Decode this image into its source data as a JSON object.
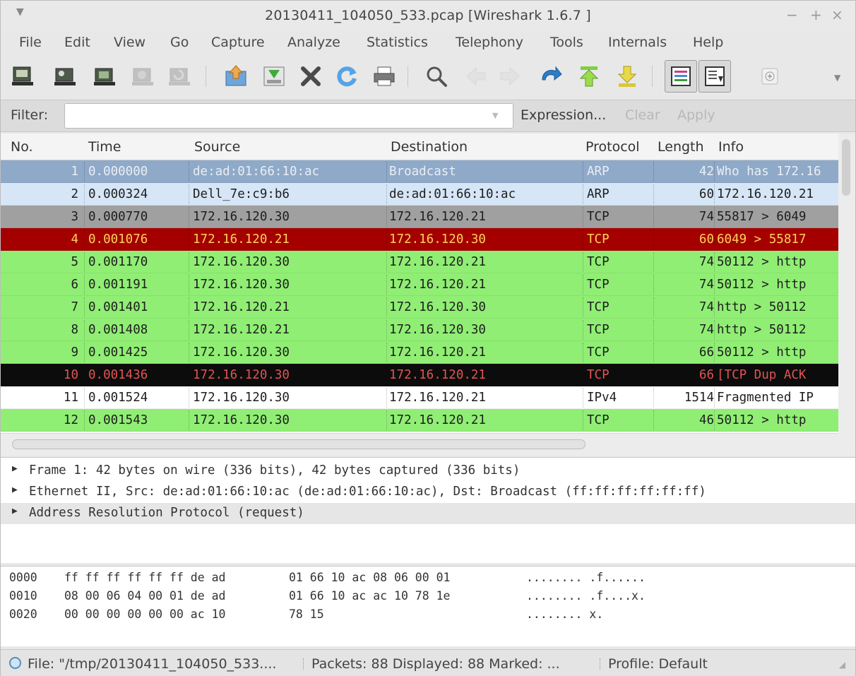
{
  "window": {
    "title": "20130411_104050_533.pcap   [Wireshark 1.6.7 ]",
    "controls": {
      "minimize": "−",
      "maximize": "+",
      "close": "×"
    }
  },
  "menu": [
    "File",
    "Edit",
    "View",
    "Go",
    "Capture",
    "Analyze",
    "Statistics",
    "Telephony",
    "Tools",
    "Internals",
    "Help"
  ],
  "toolbar": {
    "icons": [
      "interfaces-icon",
      "options-icon",
      "start-capture-icon",
      "stop-capture-icon",
      "restart-capture-icon",
      "open-file-icon",
      "save-file-icon",
      "close-file-icon",
      "reload-icon",
      "print-icon",
      "find-icon",
      "go-back-icon",
      "go-forward-icon",
      "go-to-packet-icon",
      "first-packet-icon",
      "last-packet-icon",
      "colorize-icon",
      "autoscroll-icon",
      "zoom-in-icon"
    ]
  },
  "filter": {
    "label": "Filter:",
    "value": "",
    "expression": "Expression...",
    "clear": "Clear",
    "apply": "Apply"
  },
  "packet_list": {
    "columns": [
      "No.",
      "Time",
      "Source",
      "Destination",
      "Protocol",
      "Length",
      "Info"
    ],
    "rows": [
      {
        "no": "1",
        "time": "0.000000",
        "source": "de:ad:01:66:10:ac",
        "destination": "Broadcast",
        "protocol": "ARP",
        "length": "42",
        "info": "Who has 172.16",
        "bg": "#8fa9c8",
        "fg": "#e9eef5"
      },
      {
        "no": "2",
        "time": "0.000324",
        "source": "Dell_7e:c9:b6",
        "destination": "de:ad:01:66:10:ac",
        "protocol": "ARP",
        "length": "60",
        "info": "172.16.120.21",
        "bg": "#d6e6f7",
        "fg": "#1e1e1e"
      },
      {
        "no": "3",
        "time": "0.000770",
        "source": "172.16.120.30",
        "destination": "172.16.120.21",
        "protocol": "TCP",
        "length": "74",
        "info": "55817 > 6049",
        "bg": "#a0a0a0",
        "fg": "#1e1e1e"
      },
      {
        "no": "4",
        "time": "0.001076",
        "source": "172.16.120.21",
        "destination": "172.16.120.30",
        "protocol": "TCP",
        "length": "60",
        "info": "6049 > 55817",
        "bg": "#a40000",
        "fg": "#ffd15c"
      },
      {
        "no": "5",
        "time": "0.001170",
        "source": "172.16.120.30",
        "destination": "172.16.120.21",
        "protocol": "TCP",
        "length": "74",
        "info": "50112 > http",
        "bg": "#90ee74",
        "fg": "#1e1e1e"
      },
      {
        "no": "6",
        "time": "0.001191",
        "source": "172.16.120.30",
        "destination": "172.16.120.21",
        "protocol": "TCP",
        "length": "74",
        "info": "50112 > http",
        "bg": "#90ee74",
        "fg": "#1e1e1e"
      },
      {
        "no": "7",
        "time": "0.001401",
        "source": "172.16.120.21",
        "destination": "172.16.120.30",
        "protocol": "TCP",
        "length": "74",
        "info": "http > 50112",
        "bg": "#90ee74",
        "fg": "#1e1e1e"
      },
      {
        "no": "8",
        "time": "0.001408",
        "source": "172.16.120.21",
        "destination": "172.16.120.30",
        "protocol": "TCP",
        "length": "74",
        "info": "http > 50112",
        "bg": "#90ee74",
        "fg": "#1e1e1e"
      },
      {
        "no": "9",
        "time": "0.001425",
        "source": "172.16.120.30",
        "destination": "172.16.120.21",
        "protocol": "TCP",
        "length": "66",
        "info": "50112 > http",
        "bg": "#90ee74",
        "fg": "#1e1e1e"
      },
      {
        "no": "10",
        "time": "0.001436",
        "source": "172.16.120.30",
        "destination": "172.16.120.21",
        "protocol": "TCP",
        "length": "66",
        "info": "[TCP Dup ACK",
        "bg": "#0c0c0c",
        "fg": "#e05454"
      },
      {
        "no": "11",
        "time": "0.001524",
        "source": "172.16.120.30",
        "destination": "172.16.120.21",
        "protocol": "IPv4",
        "length": "1514",
        "info": "Fragmented IP",
        "bg": "#ffffff",
        "fg": "#1e1e1e"
      },
      {
        "no": "12",
        "time": "0.001543",
        "source": "172.16.120.30",
        "destination": "172.16.120.21",
        "protocol": "TCP",
        "length": "46",
        "info": "50112 > http",
        "bg": "#90ee74",
        "fg": "#1e1e1e"
      }
    ]
  },
  "details": [
    "Frame 1: 42 bytes on wire (336 bits), 42 bytes captured (336 bits)",
    "Ethernet II, Src: de:ad:01:66:10:ac (de:ad:01:66:10:ac), Dst: Broadcast (ff:ff:ff:ff:ff:ff)",
    "Address Resolution Protocol (request)"
  ],
  "hex": [
    {
      "offset": "0000",
      "bytes1": "ff ff ff ff ff ff de ad",
      "bytes2": "01 66 10 ac 08 06 00 01",
      "ascii": "........ .f......"
    },
    {
      "offset": "0010",
      "bytes1": "08 00 06 04 00 01 de ad",
      "bytes2": "01 66 10 ac ac 10 78 1e",
      "ascii": "........ .f....x."
    },
    {
      "offset": "0020",
      "bytes1": "00 00 00 00 00 00 ac 10",
      "bytes2": "78 15",
      "ascii": "........ x."
    }
  ],
  "status": {
    "file": "File: \"/tmp/20130411_104050_533....",
    "packets": "Packets: 88 Displayed: 88 Marked: ...",
    "profile": "Profile: Default"
  }
}
